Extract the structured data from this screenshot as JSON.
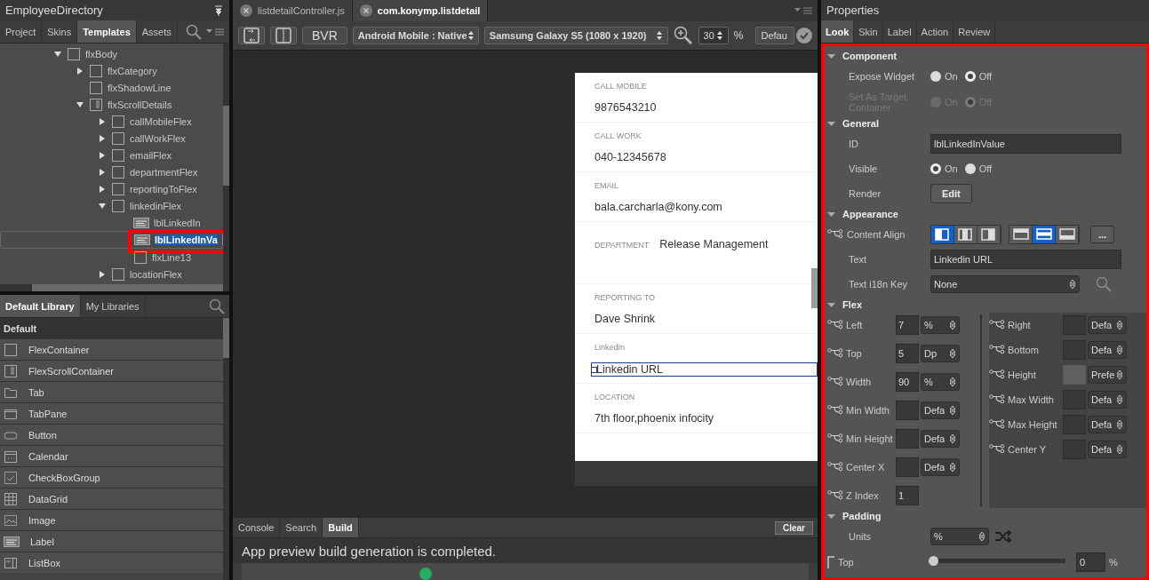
{
  "left_panel": {
    "title": "EmployeeDirectory",
    "tabs": [
      {
        "label": "Project",
        "selected": false
      },
      {
        "label": "Skins",
        "selected": false
      },
      {
        "label": "Templates",
        "selected": true
      },
      {
        "label": "Assets",
        "selected": false
      }
    ],
    "tree": [
      {
        "label": "flxBody",
        "kind": "flex",
        "expanded": true,
        "selected": false,
        "children": [
          {
            "label": "flxCategory",
            "kind": "flex",
            "expanded": false,
            "selected": false
          },
          {
            "label": "flxShadowLine",
            "kind": "flex",
            "selected": false
          },
          {
            "label": "flxScrollDetails",
            "kind": "scroll",
            "expanded": true,
            "selected": false,
            "children": [
              {
                "label": "callMobileFlex",
                "kind": "flex",
                "expanded": false,
                "selected": false
              },
              {
                "label": "callWorkFlex",
                "kind": "flex",
                "expanded": false,
                "selected": false
              },
              {
                "label": "emailFlex",
                "kind": "flex",
                "expanded": false,
                "selected": false
              },
              {
                "label": "departmentFlex",
                "kind": "flex",
                "expanded": false,
                "selected": false
              },
              {
                "label": "reportingToFlex",
                "kind": "flex",
                "expanded": false,
                "selected": false
              },
              {
                "label": "linkedinFlex",
                "kind": "flex",
                "expanded": true,
                "selected": false,
                "children": [
                  {
                    "label": "lblLinkedIn",
                    "kind": "label",
                    "selected": false
                  },
                  {
                    "label": "lblLinkedInVa",
                    "kind": "label",
                    "selected": true
                  },
                  {
                    "label": "flxLine13",
                    "kind": "flex",
                    "selected": false
                  }
                ]
              },
              {
                "label": "locationFlex",
                "kind": "flex",
                "expanded": false,
                "selected": false
              }
            ]
          }
        ]
      }
    ]
  },
  "library": {
    "tabs": [
      {
        "label": "Default Library",
        "selected": true
      },
      {
        "label": "My Libraries",
        "selected": false
      }
    ],
    "group": "Default",
    "items": [
      {
        "label": "FlexContainer",
        "kind": "flex"
      },
      {
        "label": "FlexScrollContainer",
        "kind": "scroll"
      },
      {
        "label": "Tab",
        "kind": "tab"
      },
      {
        "label": "TabPane",
        "kind": "tabpane"
      },
      {
        "label": "Button",
        "kind": "button"
      },
      {
        "label": "Calendar",
        "kind": "calendar"
      },
      {
        "label": "CheckBoxGroup",
        "kind": "checkbox"
      },
      {
        "label": "DataGrid",
        "kind": "grid"
      },
      {
        "label": "Image",
        "kind": "image"
      },
      {
        "label": "Label",
        "kind": "label"
      },
      {
        "label": "ListBox",
        "kind": "listbox"
      }
    ]
  },
  "editor": {
    "tabs": [
      {
        "label": "listdetailController.js",
        "selected": false
      },
      {
        "label": "com.konymp.listdetail",
        "selected": true
      }
    ],
    "toolbar": {
      "bvr": "BVR",
      "platform": "Android Mobile : Native",
      "device": "Samsung Galaxy S5 (1080 x 1920)",
      "zoom": "30",
      "zoom_unit": "%",
      "mode": "Defau"
    },
    "preview": {
      "fields": [
        {
          "label": "CALL MOBILE",
          "value": "9876543210",
          "kind": "stacked",
          "selected": false
        },
        {
          "label": "CALL WORK",
          "value": "040-12345678",
          "kind": "stacked",
          "selected": false
        },
        {
          "label": "EMAIL",
          "value": "bala.carcharla@kony.com",
          "kind": "stacked",
          "selected": false
        },
        {
          "label": "DEPARTMENT",
          "value": "Release Management",
          "kind": "inline",
          "selected": false
        },
        {
          "label": "REPORTING TO",
          "value": "Dave Shrink",
          "kind": "stacked",
          "selected": false
        },
        {
          "label": "LinkedIn",
          "value": "Linkedin URL",
          "kind": "stacked",
          "selected": true
        },
        {
          "label": "LOCATION",
          "value": "7th floor,phoenix infocity",
          "kind": "stacked",
          "selected": false
        }
      ]
    },
    "output": {
      "tabs": [
        {
          "label": "Console",
          "selected": false
        },
        {
          "label": "Search",
          "selected": false
        },
        {
          "label": "Build",
          "selected": true
        }
      ],
      "clear": "Clear",
      "message": "App preview build generation is completed."
    }
  },
  "properties": {
    "title": "Properties",
    "tabs": [
      {
        "label": "Look",
        "selected": true
      },
      {
        "label": "Skin",
        "selected": false
      },
      {
        "label": "Label",
        "selected": false
      },
      {
        "label": "Action",
        "selected": false
      },
      {
        "label": "Review",
        "selected": false
      }
    ],
    "sections": [
      {
        "title": "Component",
        "expanded": true,
        "rows": [
          {
            "kind": "radio",
            "label": "Expose Widget",
            "disabled": false,
            "options": [
              {
                "label": "On",
                "selected": false
              },
              {
                "label": "Off",
                "selected": true
              }
            ]
          },
          {
            "kind": "radio",
            "label": "Set As Target Container",
            "disabled": true,
            "options": [
              {
                "label": "On",
                "selected": false
              },
              {
                "label": "Off",
                "selected": true
              }
            ]
          }
        ]
      },
      {
        "title": "General",
        "expanded": true,
        "rows": [
          {
            "kind": "field",
            "label": "ID",
            "value": "lblLinkedInValue"
          },
          {
            "kind": "radio",
            "label": "Visible",
            "disabled": false,
            "options": [
              {
                "label": "On",
                "selected": true
              },
              {
                "label": "Off",
                "selected": false
              }
            ]
          },
          {
            "kind": "button",
            "label": "Render",
            "button": "Edit"
          }
        ]
      },
      {
        "title": "Appearance",
        "expanded": true,
        "rows": [
          {
            "kind": "align",
            "label": "Content Align",
            "horizontal": [
              {
                "selected": true
              },
              {
                "selected": false
              },
              {
                "selected": false
              }
            ],
            "vertical": [
              {
                "selected": false
              },
              {
                "selected": true
              },
              {
                "selected": false
              }
            ],
            "more": "..."
          },
          {
            "kind": "field",
            "label": "Text",
            "value": "Linkedin URL"
          },
          {
            "kind": "dropdown",
            "label": "Text i18n Key",
            "value": "None"
          }
        ]
      },
      {
        "title": "Flex",
        "expanded": true,
        "rows": [
          {
            "kind": "flex",
            "left": [
              {
                "label": "Left",
                "value": "7",
                "unit": "%",
                "disabled": false
              },
              {
                "label": "Top",
                "value": "5",
                "unit": "Dp",
                "disabled": false
              },
              {
                "label": "Width",
                "value": "90",
                "unit": "%",
                "disabled": false
              },
              {
                "label": "Min Width",
                "unit": "Defa",
                "disabled": false
              },
              {
                "label": "Min Height",
                "unit": "Defa",
                "disabled": false
              },
              {
                "label": "Center X",
                "unit": "Defa",
                "disabled": false
              },
              {
                "label": "Z Index",
                "value": "1",
                "disabled": false
              }
            ],
            "right": [
              {
                "label": "Right",
                "unit": "Defa",
                "disabled": false
              },
              {
                "label": "Bottom",
                "unit": "Defa",
                "disabled": false
              },
              {
                "label": "Height",
                "unit": "Prefe",
                "disabled": true
              },
              {
                "label": "Max Width",
                "unit": "Defa",
                "disabled": false
              },
              {
                "label": "Max Height",
                "unit": "Defa",
                "disabled": false
              },
              {
                "label": "Center Y",
                "unit": "Defa",
                "disabled": false
              }
            ]
          }
        ]
      },
      {
        "title": "Padding",
        "expanded": true,
        "rows": [
          {
            "kind": "units",
            "label": "Units",
            "value": "%"
          },
          {
            "kind": "slider",
            "label": "Top",
            "level": 0,
            "value": "0",
            "unit": "%"
          }
        ]
      }
    ]
  }
}
